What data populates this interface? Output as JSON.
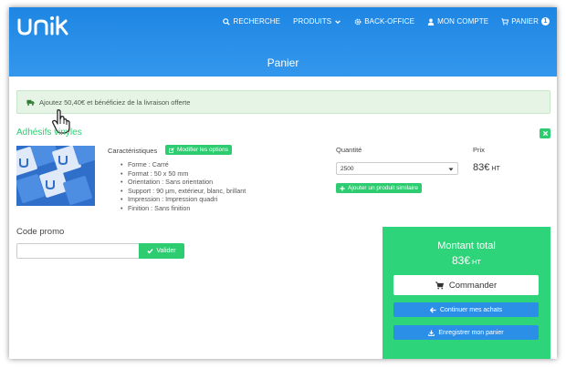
{
  "header": {
    "logo_text": "unik",
    "nav": [
      {
        "label": "RECHERCHE",
        "icon": "search-icon"
      },
      {
        "label": "PRODUITS",
        "icon": "chevron-down-icon"
      },
      {
        "label": "BACK-OFFICE",
        "icon": "gear-icon"
      },
      {
        "label": "MON COMPTE",
        "icon": "user-icon"
      },
      {
        "label": "PANIER",
        "icon": "cart-icon",
        "badge": "1"
      }
    ],
    "page_title": "Panier"
  },
  "alert": {
    "text": "Ajoutez 50,40€ et bénéficiez de la livraison offerte",
    "icon": "truck-icon"
  },
  "product": {
    "title": "Adhésifs vinyles",
    "characteristics_label": "Caractéristiques",
    "modify_button": "Modifier les options",
    "specs": [
      "Forme : Carré",
      "Format : 50 x 50 mm",
      "Orientation : Sans orientation",
      "Support : 90 µm, extérieur, blanc, brillant",
      "Impression : Impression quadri",
      "Finition : Sans finition"
    ],
    "quantity_label": "Quantité",
    "quantity_value": "2500",
    "similar_button": "Ajouter un produit similaire",
    "price_label": "Prix",
    "price_value": "83€",
    "price_suffix": "HT"
  },
  "promo": {
    "label": "Code promo",
    "input_value": "",
    "button": "Valider"
  },
  "total": {
    "title": "Montant total",
    "amount": "83€",
    "suffix": "HT",
    "order_button": "Commander",
    "continue_button": "Continuer mes achats",
    "save_button": "Enregistrer mon panier"
  },
  "colors": {
    "header_blue": "#1e86e3",
    "accent_green": "#2ecc71",
    "total_green": "#2ed47a",
    "button_blue": "#2b8fe8"
  }
}
